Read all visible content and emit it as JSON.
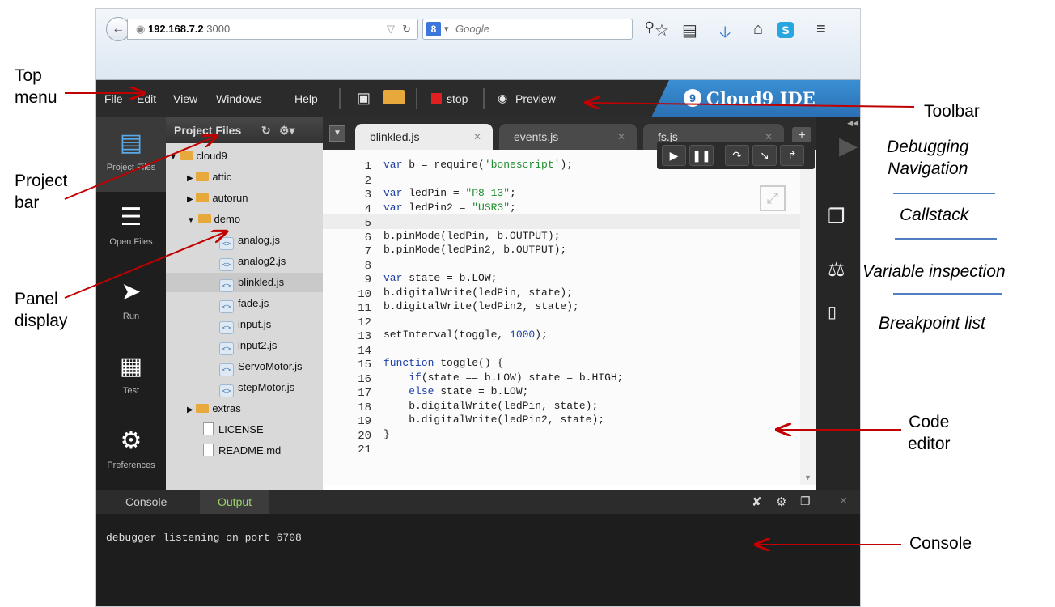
{
  "browser": {
    "url_host": "192.168.7.2",
    "url_port": ":3000",
    "search_placeholder": "Google",
    "search_engine_badge": "8"
  },
  "menu": [
    "File",
    "Edit",
    "View",
    "Windows",
    "Help"
  ],
  "toolbar": {
    "stop_label": "stop",
    "preview_label": "Preview",
    "brand": "Cloud9 IDE"
  },
  "sidebar": [
    {
      "label": "Project Files",
      "icon": "project-files-icon"
    },
    {
      "label": "Open Files",
      "icon": "open-files-icon"
    },
    {
      "label": "Run",
      "icon": "run-icon"
    },
    {
      "label": "Test",
      "icon": "test-icon"
    },
    {
      "label": "Preferences",
      "icon": "gear-icon"
    }
  ],
  "panel_title": "Project Files",
  "tree": [
    {
      "label": "cloud9",
      "type": "folder",
      "expanded": true
    },
    {
      "label": "attic",
      "type": "folder"
    },
    {
      "label": "autorun",
      "type": "folder"
    },
    {
      "label": "demo",
      "type": "folder",
      "expanded": true
    },
    {
      "label": "analog.js",
      "type": "js"
    },
    {
      "label": "analog2.js",
      "type": "js"
    },
    {
      "label": "blinkled.js",
      "type": "js",
      "selected": true
    },
    {
      "label": "fade.js",
      "type": "js"
    },
    {
      "label": "input.js",
      "type": "js"
    },
    {
      "label": "input2.js",
      "type": "js"
    },
    {
      "label": "ServoMotor.js",
      "type": "js"
    },
    {
      "label": "stepMotor.js",
      "type": "js"
    },
    {
      "label": "extras",
      "type": "folder"
    },
    {
      "label": "LICENSE",
      "type": "file"
    },
    {
      "label": "README.md",
      "type": "file"
    }
  ],
  "tabs": [
    "blinkled.js",
    "events.js",
    "fs.js"
  ],
  "code_lines": [
    "var b = require('bonescript');",
    "",
    "var ledPin = \"P8_13\";",
    "var ledPin2 = \"USR3\";",
    "",
    "b.pinMode(ledPin, b.OUTPUT);",
    "b.pinMode(ledPin2, b.OUTPUT);",
    "",
    "var state = b.LOW;",
    "b.digitalWrite(ledPin, state);",
    "b.digitalWrite(ledPin2, state);",
    "",
    "setInterval(toggle, 1000);",
    "",
    "function toggle() {",
    "    if(state == b.LOW) state = b.HIGH;",
    "    else state = b.LOW;",
    "    b.digitalWrite(ledPin, state);",
    "    b.digitalWrite(ledPin2, state);",
    "}",
    ""
  ],
  "console": {
    "tabs": [
      "Console",
      "Output"
    ],
    "active_tab": "Output",
    "text": "debugger listening on port 6708"
  },
  "annotations": {
    "top_menu": "Top\nmenu",
    "project_bar": "Project\nbar",
    "panel_display": "Panel\ndisplay",
    "toolbar": "Toolbar",
    "debugging_navigation": "Debugging\nNavigation",
    "callstack": "Callstack",
    "variable_inspection": "Variable inspection",
    "breakpoint_list": "Breakpoint list",
    "code_editor": "Code\neditor",
    "console": "Console"
  },
  "colors": {
    "annotation_arrow": "#c00000",
    "separator": "#4f7ec2",
    "brand_blue": "#2a6fb3"
  }
}
